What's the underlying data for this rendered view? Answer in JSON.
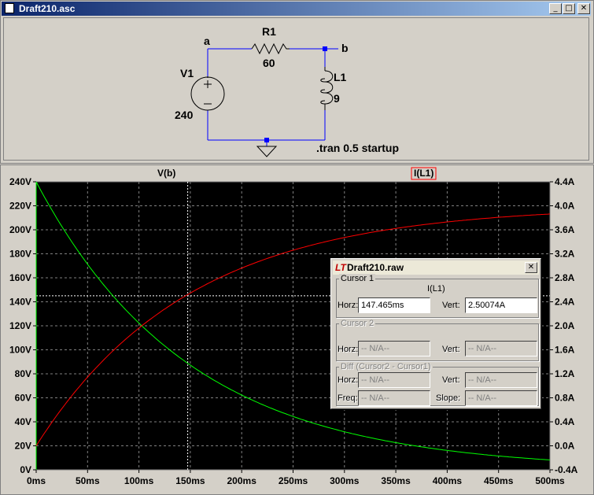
{
  "schematic_window": {
    "title": "Draft210.asc",
    "buttons": {
      "minimize": "_",
      "maximize": "□",
      "close": "✕"
    },
    "components": {
      "source_name": "V1",
      "source_value": "240",
      "resistor_name": "R1",
      "resistor_value": "60",
      "inductor_name": "L1",
      "inductor_value": "9",
      "node_a": "a",
      "node_b": "b",
      "directive": ".tran 0.5 startup"
    }
  },
  "plot": {
    "trace_vb_label": "V(b)",
    "trace_il_label": "I(L1)",
    "left_ticks": [
      "240V",
      "220V",
      "200V",
      "180V",
      "160V",
      "140V",
      "120V",
      "100V",
      "80V",
      "60V",
      "40V",
      "20V",
      "0V"
    ],
    "right_ticks": [
      "4.4A",
      "4.0A",
      "3.6A",
      "3.2A",
      "2.8A",
      "2.4A",
      "2.0A",
      "1.6A",
      "1.2A",
      "0.8A",
      "0.4A",
      "0.0A",
      "-0.4A"
    ],
    "x_ticks": [
      "0ms",
      "50ms",
      "100ms",
      "150ms",
      "200ms",
      "250ms",
      "300ms",
      "350ms",
      "400ms",
      "450ms",
      "500ms"
    ],
    "colors": {
      "vb": "#00ff00",
      "il": "#ff0000",
      "background": "#000000",
      "grid": "#808080",
      "cursor": "#ffffff"
    }
  },
  "chart_data": {
    "type": "line",
    "x_unit": "ms",
    "xlim": [
      0,
      500
    ],
    "ylim_left": [
      0,
      240
    ],
    "ylim_right": [
      -0.4,
      4.4
    ],
    "x": [
      0,
      50,
      100,
      150,
      200,
      250,
      300,
      350,
      400,
      450,
      500
    ],
    "series": [
      {
        "name": "V(b)",
        "axis": "left",
        "values": [
          240,
          171.3,
          122.3,
          87.3,
          62.3,
          44.5,
          31.8,
          22.7,
          16.2,
          11.5,
          8.2
        ]
      },
      {
        "name": "I(L1)",
        "axis": "right",
        "values": [
          0,
          1.145,
          1.962,
          2.545,
          2.961,
          3.258,
          3.47,
          3.622,
          3.73,
          3.808,
          3.863
        ]
      }
    ],
    "cursor": {
      "x": 147.465,
      "y": 2.50074
    }
  },
  "cursor_dialog": {
    "title": "Draft210.raw",
    "close": "✕",
    "cursor1_title": "Cursor 1",
    "cursor1_trace": "I(L1)",
    "horz_label": "Horz:",
    "vert_label": "Vert:",
    "cursor1_horz": "147.465ms",
    "cursor1_vert": "2.50074A",
    "cursor2_title": "Cursor 2",
    "na": "-- N/A--",
    "diff_title": "Diff (Cursor2 - Cursor1)",
    "freq_label": "Freq:",
    "slope_label": "Slope:"
  }
}
